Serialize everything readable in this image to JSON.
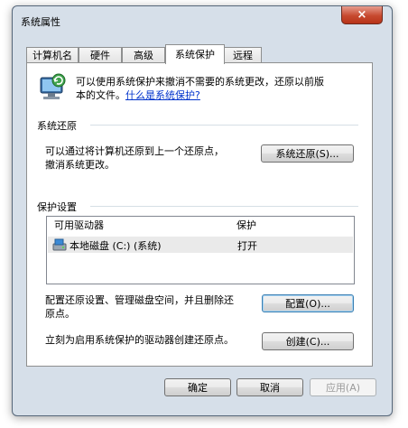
{
  "window": {
    "title": "系统属性",
    "close_label": "×"
  },
  "tabs": [
    {
      "label": "计算机名",
      "active": false
    },
    {
      "label": "硬件",
      "active": false
    },
    {
      "label": "高级",
      "active": false
    },
    {
      "label": "系统保护",
      "active": true
    },
    {
      "label": "远程",
      "active": false
    }
  ],
  "intro": {
    "line1": "可以使用系统保护来撤消不需要的系统更改，还原以前版",
    "line2_prefix": "本的文件。",
    "link": "什么是系统保护?"
  },
  "restore": {
    "heading": "系统还原",
    "desc_line1": "可以通过将计算机还原到上一个还原点，",
    "desc_line2": "撤消系统更改。",
    "button": "系统还原(S)..."
  },
  "protection": {
    "heading": "保护设置",
    "columns": [
      "可用驱动器",
      "保护"
    ],
    "rows": [
      {
        "drive": "本地磁盘 (C:) (系统)",
        "protection": "打开"
      }
    ],
    "config_desc_line1": "配置还原设置、管理磁盘空间，并且删除还",
    "config_desc_line2": "原点。",
    "config_button": "配置(O)...",
    "create_desc": "立刻为启用系统保护的驱动器创建还原点。",
    "create_button": "创建(C)..."
  },
  "footer": {
    "ok": "确定",
    "cancel": "取消",
    "apply": "应用(A)"
  }
}
